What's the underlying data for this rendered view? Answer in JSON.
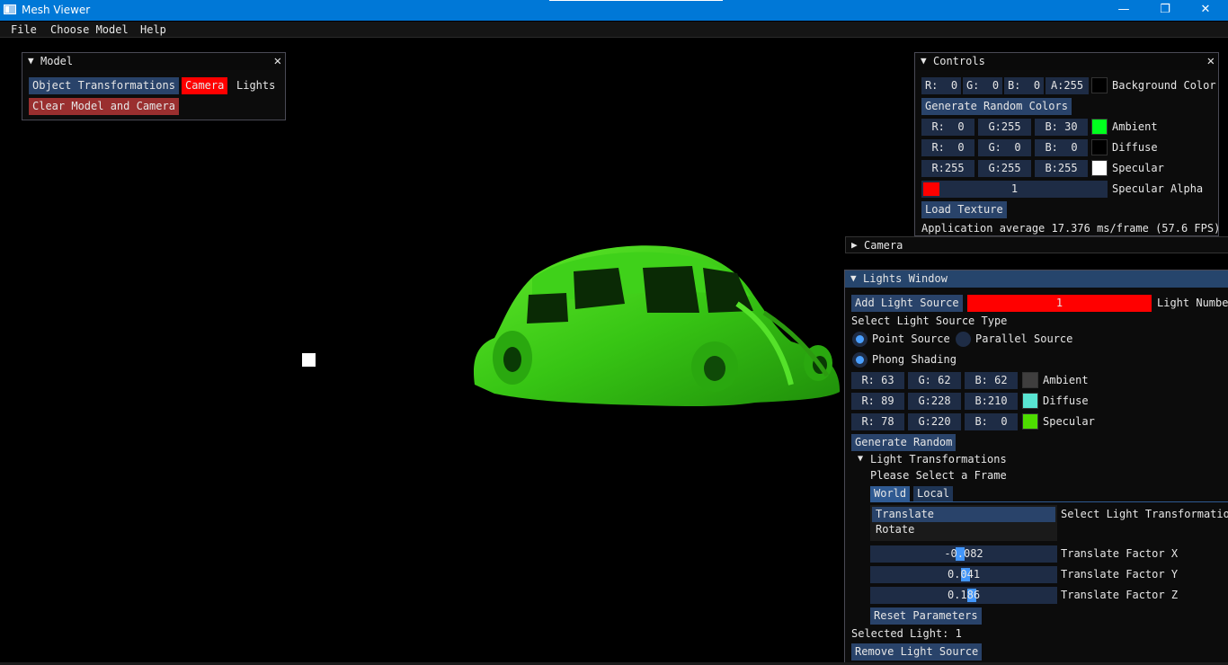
{
  "titlebar": {
    "title": "Mesh Viewer",
    "minimize": "—",
    "maximize": "❐",
    "close": "✕"
  },
  "menubar": {
    "items": [
      "File",
      "Choose Model",
      "Help"
    ]
  },
  "model_window": {
    "title": "Model",
    "arrow": "▼",
    "close": "✕",
    "object_transformations": "Object Transformations",
    "camera": "Camera",
    "lights": "Lights",
    "clear": "Clear Model and Camera"
  },
  "controls_window": {
    "title": "Controls",
    "arrow": "▼",
    "close": "✕",
    "bg": {
      "r": "R:  0",
      "g": "G:  0",
      "b": "B:  0",
      "a": "A:255",
      "label": "Background Color",
      "color": "#000000"
    },
    "generate_random_colors": "Generate Random Colors",
    "ambient": {
      "r": "R:  0",
      "g": "G:255",
      "b": "B: 30",
      "label": "Ambient",
      "color": "#00ff1e"
    },
    "diffuse": {
      "r": "R:  0",
      "g": "G:  0",
      "b": "B:  0",
      "label": "Diffuse",
      "color": "#000000"
    },
    "specular": {
      "r": "R:255",
      "g": "G:255",
      "b": "B:255",
      "label": "Specular",
      "color": "#ffffff"
    },
    "specular_alpha": {
      "value": "1",
      "label": "Specular Alpha"
    },
    "load_texture": "Load Texture",
    "fps_text": "Application average 17.376 ms/frame (57.6 FPS)"
  },
  "camera_window": {
    "arrow": "▶",
    "title": "Camera"
  },
  "lights_window": {
    "arrow": "▼",
    "title": "Lights Window",
    "add_light": "Add Light Source",
    "light_number_value": "1",
    "light_number_label": "Light Number",
    "select_type": "Select Light Source Type",
    "point_source": "Point Source",
    "parallel_source": "Parallel Source",
    "phong": "Phong Shading",
    "ambient": {
      "r": "R: 63",
      "g": "G: 62",
      "b": "B: 62",
      "label": "Ambient",
      "color": "#3f3e3e"
    },
    "diffuse": {
      "r": "R: 89",
      "g": "G:228",
      "b": "B:210",
      "label": "Diffuse",
      "color": "#59e4d2"
    },
    "specular": {
      "r": "R: 78",
      "g": "G:220",
      "b": "B:  0",
      "label": "Specular",
      "color": "#4edc00"
    },
    "generate_random": "Generate Random",
    "light_transformations": "Light Transformations",
    "tree_arrow": "▼",
    "select_frame": "Please Select a Frame",
    "tab_world": "World",
    "tab_local": "Local",
    "translate": "Translate",
    "rotate": "Rotate",
    "select_transformation": "Select Light Transformation",
    "factor_x": {
      "value": "-0.082",
      "label": "Translate Factor X"
    },
    "factor_y": {
      "value": "0.041",
      "label": "Translate Factor Y"
    },
    "factor_z": {
      "value": "0.186",
      "label": "Translate Factor Z"
    },
    "reset": "Reset Parameters",
    "selected_light": "Selected Light: 1",
    "remove_light": "Remove Light Source"
  }
}
